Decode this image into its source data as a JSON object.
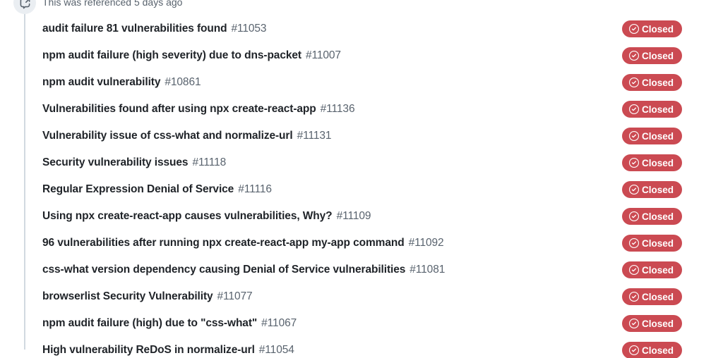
{
  "event": {
    "icon": "cross-reference-icon",
    "text": "This was referenced 5 days ago"
  },
  "colors": {
    "closed_badge_bg": "#cb4a52",
    "closed_badge_text": "#ffffff",
    "issue_title": "#1f2328",
    "issue_number": "#59636e",
    "timeline_rail": "#d1d9e0",
    "avatar_bg": "#eaeef2"
  },
  "state_badge": {
    "label": "Closed",
    "icon": "check-circle-icon"
  },
  "issues": [
    {
      "title": "audit failure 81 vulnerabilities found",
      "number": "#11053",
      "state": "Closed"
    },
    {
      "title": "npm audit failure (high severity) due to dns-packet",
      "number": "#11007",
      "state": "Closed"
    },
    {
      "title": "npm audit vulnerability",
      "number": "#10861",
      "state": "Closed"
    },
    {
      "title": "Vulnerabilities found after using npx create-react-app",
      "number": "#11136",
      "state": "Closed"
    },
    {
      "title": "Vulnerability issue of css-what and normalize-url",
      "number": "#11131",
      "state": "Closed"
    },
    {
      "title": "Security vulnerability issues",
      "number": "#11118",
      "state": "Closed"
    },
    {
      "title": "Regular Expression Denial of Service",
      "number": "#11116",
      "state": "Closed"
    },
    {
      "title": "Using npx create-react-app causes vulnerabilities, Why?",
      "number": "#11109",
      "state": "Closed"
    },
    {
      "title": "96 vulnerabilities after running npx create-react-app my-app command",
      "number": "#11092",
      "state": "Closed"
    },
    {
      "title": "css-what version dependency causing Denial of Service vulnerabilities",
      "number": "#11081",
      "state": "Closed"
    },
    {
      "title": "browserlist Security Vulnerability",
      "number": "#11077",
      "state": "Closed"
    },
    {
      "title": "npm audit failure (high) due to \"css-what\"",
      "number": "#11067",
      "state": "Closed"
    },
    {
      "title": "High vulnerability ReDoS in normalize-url",
      "number": "#11054",
      "state": "Closed"
    }
  ]
}
